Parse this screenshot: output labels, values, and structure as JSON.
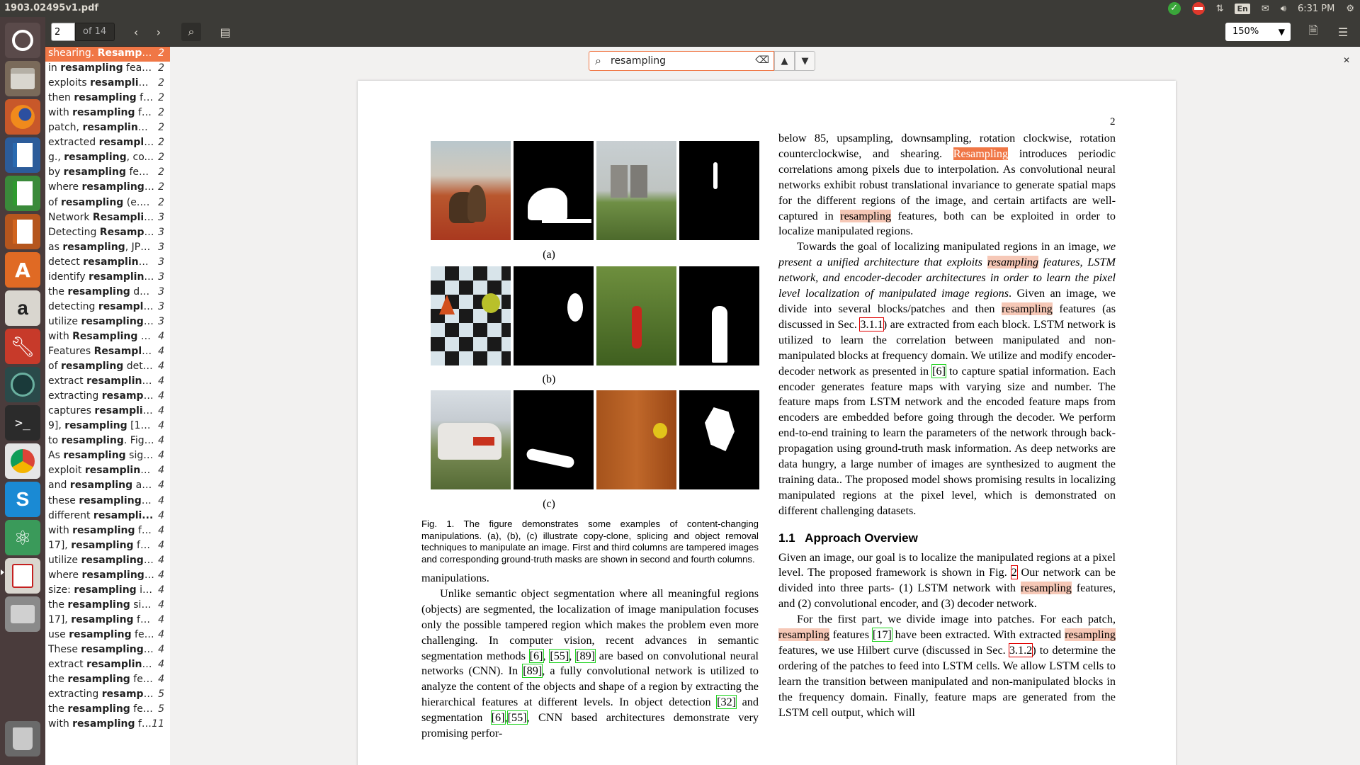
{
  "window": {
    "title": "1903.02495v1.pdf"
  },
  "tray": {
    "lang": "En",
    "time": "6:31 PM"
  },
  "toolbar": {
    "page_value": "2",
    "page_of": "of 14",
    "zoom": "150%"
  },
  "find": {
    "query": "resampling",
    "clear_icon": "backspace-icon",
    "prev_icon": "chevron-up-icon",
    "next_icon": "chevron-down-icon"
  },
  "results": [
    {
      "pre": "shearing. ",
      "b": "Resampli...",
      "post": "",
      "p": "2"
    },
    {
      "pre": "in ",
      "b": "resampling",
      "post": " feat...",
      "p": "2"
    },
    {
      "pre": "exploits ",
      "b": "resamplin...",
      "post": "",
      "p": "2"
    },
    {
      "pre": "then ",
      "b": "resampling",
      "post": " fe...",
      "p": "2"
    },
    {
      "pre": "with ",
      "b": "resampling",
      "post": " fe...",
      "p": "2"
    },
    {
      "pre": "patch, ",
      "b": "resampling",
      "post": " ...",
      "p": "2"
    },
    {
      "pre": "extracted ",
      "b": "resampli...",
      "post": "",
      "p": "2"
    },
    {
      "pre": "g., ",
      "b": "resampling",
      "post": ", co...",
      "p": "2"
    },
    {
      "pre": "by ",
      "b": "resampling",
      "post": " feat...",
      "p": "2"
    },
    {
      "pre": "where ",
      "b": "resampling",
      "post": " ...",
      "p": "2"
    },
    {
      "pre": "of ",
      "b": "resampling",
      "post": " (e.g....",
      "p": "2"
    },
    {
      "pre": "Network ",
      "b": "Resampli...",
      "post": "",
      "p": "3"
    },
    {
      "pre": "Detecting ",
      "b": "Resampl...",
      "post": "",
      "p": "3"
    },
    {
      "pre": "as ",
      "b": "resampling",
      "post": ", JPE...",
      "p": "3"
    },
    {
      "pre": "detect ",
      "b": "resampling",
      "post": " i...",
      "p": "3"
    },
    {
      "pre": "identify ",
      "b": "resamplin...",
      "post": "",
      "p": "3"
    },
    {
      "pre": "the ",
      "b": "resampling",
      "post": " det...",
      "p": "3"
    },
    {
      "pre": "detecting ",
      "b": "resampli...",
      "post": "",
      "p": "3"
    },
    {
      "pre": "utilize ",
      "b": "resampling",
      "post": " f...",
      "p": "3"
    },
    {
      "pre": "with ",
      "b": "Resampling",
      "post": " F...",
      "p": "4"
    },
    {
      "pre": "Features ",
      "b": "Resampli...",
      "post": "",
      "p": "4"
    },
    {
      "pre": "of ",
      "b": "resampling",
      "post": " dete...",
      "p": "4"
    },
    {
      "pre": "extract ",
      "b": "resampling...",
      "post": "",
      "p": "4"
    },
    {
      "pre": "extracting ",
      "b": "resampl...",
      "post": "",
      "p": "4"
    },
    {
      "pre": "captures ",
      "b": "resamplin...",
      "post": "",
      "p": "4"
    },
    {
      "pre": "9], ",
      "b": "resampling",
      "post": " [10],...",
      "p": "4"
    },
    {
      "pre": "to ",
      "b": "resampling",
      "post": ". Fig. ...",
      "p": "4"
    },
    {
      "pre": "As ",
      "b": "resampling",
      "post": " sign...",
      "p": "4"
    },
    {
      "pre": "exploit ",
      "b": "resampling",
      "post": " ...",
      "p": "4"
    },
    {
      "pre": "and ",
      "b": "resampling",
      "post": " are...",
      "p": "4"
    },
    {
      "pre": "these ",
      "b": "resampling",
      "post": " f...",
      "p": "4"
    },
    {
      "pre": "different ",
      "b": "resampli...",
      "post": "",
      "p": "4"
    },
    {
      "pre": "with ",
      "b": "resampling",
      "post": " fe...",
      "p": "4"
    },
    {
      "pre": "17], ",
      "b": "resampling",
      "post": " fea...",
      "p": "4"
    },
    {
      "pre": "utilize ",
      "b": "resampling",
      "post": " f...",
      "p": "4"
    },
    {
      "pre": "where ",
      "b": "resampling",
      "post": " ...",
      "p": "4"
    },
    {
      "pre": "size: ",
      "b": "resampling",
      "post": " is ...",
      "p": "4"
    },
    {
      "pre": "the ",
      "b": "resampling",
      "post": " sig...",
      "p": "4"
    },
    {
      "pre": "17], ",
      "b": "resampling",
      "post": " fea...",
      "p": "4"
    },
    {
      "pre": "use ",
      "b": "resampling",
      "post": " fea...",
      "p": "4"
    },
    {
      "pre": "These ",
      "b": "resampling",
      "post": " f...",
      "p": "4"
    },
    {
      "pre": "extract ",
      "b": "resampling...",
      "post": "",
      "p": "4"
    },
    {
      "pre": "the ",
      "b": "resampling",
      "post": " fea...",
      "p": "4"
    },
    {
      "pre": "extracting ",
      "b": "resampl...",
      "post": "",
      "p": "5"
    },
    {
      "pre": "the ",
      "b": "resampling",
      "post": " feat...",
      "p": "5"
    },
    {
      "pre": "with ",
      "b": "resampling",
      "post": " fe...",
      "p": "11"
    }
  ],
  "document": {
    "page_number": "2",
    "fig_labels": [
      "(a)",
      "(b)",
      "(c)"
    ],
    "fig_caption": "Fig. 1. The figure demonstrates some examples of content-changing manipulations. (a), (b), (c) illustrate copy-clone, splicing and object removal techniques to manipulate an image. First and third columns are tampered images and corresponding ground-truth masks are shown in second and fourth columns.",
    "left_col": {
      "p1": "manipulations.",
      "p2a": "Unlike semantic object segmentation where all meaningful regions (objects) are segmented, the localization of image manipulation focuses only the possible tampered region which makes the problem even more challenging. In computer vision, recent advances in semantic segmentation methods ",
      "r6": "[6]",
      "c1": ", ",
      "r55": "[55]",
      "c2": ", ",
      "r89": "[89]",
      "p2b": " are based on convolutional neural networks (CNN). In ",
      "r89b": "[89]",
      "p2c": ", a fully convolutional network is utilized to analyze the content of the objects and shape of a region by extracting the hierarchical features at different levels. In object detection ",
      "r32": "[32]",
      "p2d": " and segmentation ",
      "r6b": "[6]",
      "p2e": ",",
      "r55b": "[55]",
      "p2f": ", CNN based architectures demonstrate very promising perfor-"
    },
    "right_col": {
      "p1a": "below 85, upsampling, downsampling, rotation clockwise, rotation counterclockwise, and shearing. ",
      "hl1": "Resampling",
      "p1b": " introduces periodic correlations among pixels due to interpolation. As convolutional neural networks exhibit robust translational invariance to generate spatial maps for the different regions of the image, and certain artifacts are well-captured in ",
      "hl2": "resampling",
      "p1c": " features, both can be exploited in order to localize manipulated regions.",
      "p2a": "Towards the goal of localizing manipulated regions in an image, ",
      "p2i1": "we present a unified architecture that exploits ",
      "hl3": "resampling",
      "p2i2": " features, LSTM network, and encoder-decoder architectures in order to learn the pixel level localization of manipulated image regions",
      "p2b": ". Given an image, we divide into several blocks/patches and then ",
      "hl4": "resampling",
      "p2c": " features (as discussed in Sec. ",
      "ref311": "3.1.1",
      "p2d": ") are extracted from each block. LSTM network is utilized to learn the correlation between manipulated and non-manipulated blocks at frequency domain. We utilize and modify encoder-decoder network as presented in ",
      "ref6": "[6]",
      "p2e": " to capture spatial information. Each encoder generates feature maps with varying size and number. The feature maps from LSTM network and the encoded feature maps from encoders are embedded before going through the decoder. We perform end-to-end training to learn the parameters of the network through back-propagation using ground-truth mask information. As deep networks are data hungry, a large number of images are synthesized to augment the training data.. The proposed model shows promising results in localizing manipulated regions at the pixel level, which is demonstrated on different challenging datasets.",
      "heading": "1.1   Approach Overview",
      "p3a": "Given an image, our goal is to localize the manipulated regions at a pixel level. The proposed framework is shown in Fig. ",
      "ref2": "2",
      "p3b": " Our network can be divided into three parts- (1) LSTM network with ",
      "hl5": "resampling",
      "p3c": " features, and (2) convolutional encoder, and (3) decoder network.",
      "p4a": "For the first part, we divide image into patches. For each patch, ",
      "hl6": "resampling",
      "p4b": " features ",
      "ref17": "[17]",
      "p4c": " have been extracted. With extracted ",
      "hl7": "resampling",
      "p4d": " features, we use Hilbert curve (discussed in Sec. ",
      "ref312": "3.1.2",
      "p4e": ") to determine the ordering of the patches to feed into LSTM cells. We allow LSTM cells to learn the transition between manipulated and non-manipulated blocks in the frequency domain. Finally, feature maps are generated from the LSTM cell output, which will"
    }
  }
}
